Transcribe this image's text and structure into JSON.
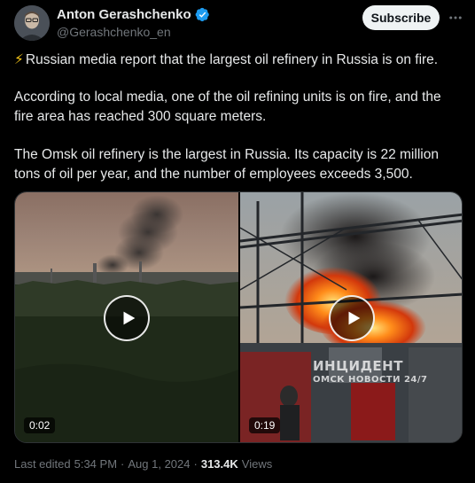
{
  "author": {
    "display_name": "Anton Gerashchenko",
    "handle": "@Gerashchenko_en",
    "verified": true
  },
  "header": {
    "subscribe_label": "Subscribe",
    "more_icon": "more-horizontal-icon"
  },
  "post": {
    "line1_emoji": "⚡",
    "line1": "Russian media report that the largest oil refinery in Russia is on fire.",
    "paragraph2": "According to local media, one of the oil refining units is on fire, and the fire area has reached 300 square meters.",
    "paragraph3": "The Omsk oil refinery is the largest in Russia. Its capacity is 22 million tons of oil per year, and the number of employees exceeds 3,500."
  },
  "media": {
    "videos": [
      {
        "duration": "0:02"
      },
      {
        "duration": "0:19",
        "watermark_line1": "ИНЦИДЕНТ",
        "watermark_line2": "ОМСК НОВОСТИ 24/7"
      }
    ]
  },
  "footer": {
    "edited_label": "Last edited",
    "time": "5:34 PM",
    "separator": "·",
    "date": "Aug 1, 2024",
    "separator2": "·",
    "views_count": "313.4K",
    "views_label": "Views"
  },
  "colors": {
    "background": "#000000",
    "text": "#e7e9ea",
    "muted": "#71767b",
    "verified": "#1d9bf0",
    "subscribe_bg": "#eff3f4"
  }
}
